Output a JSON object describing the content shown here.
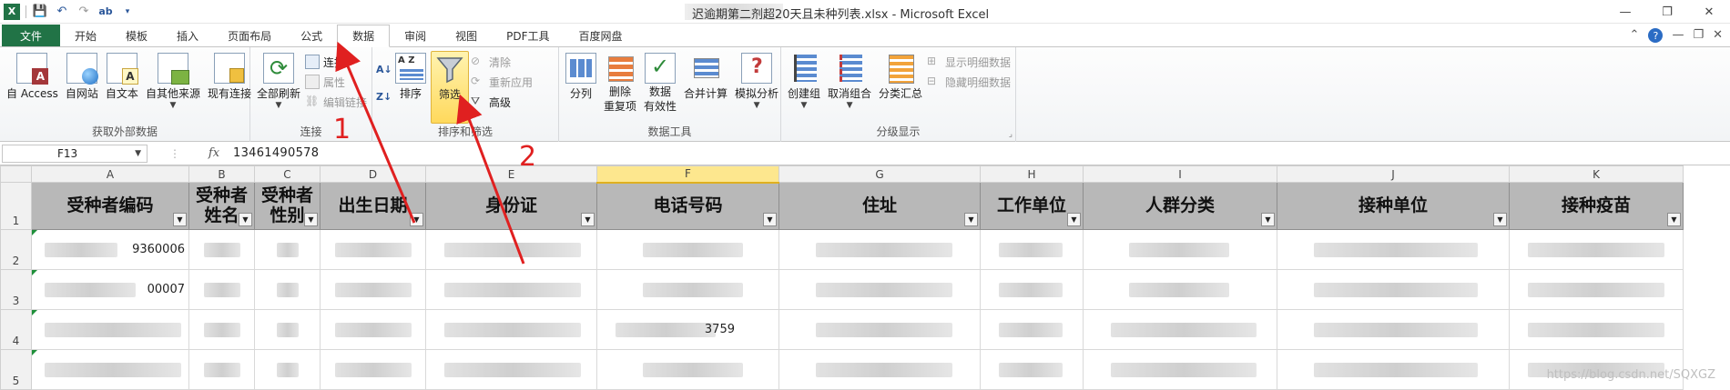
{
  "window": {
    "title": "迟逾期第二剂超20天且未种列表.xlsx - Microsoft Excel",
    "controls": [
      "—",
      "❐",
      "✕"
    ]
  },
  "tabs": [
    {
      "label": "文件"
    },
    {
      "label": "开始"
    },
    {
      "label": "模板"
    },
    {
      "label": "插入"
    },
    {
      "label": "页面布局"
    },
    {
      "label": "公式"
    },
    {
      "label": "数据"
    },
    {
      "label": "审阅"
    },
    {
      "label": "视图"
    },
    {
      "label": "PDF工具"
    },
    {
      "label": "百度网盘"
    }
  ],
  "ribbon": {
    "external": {
      "label": "获取外部数据",
      "buttons": [
        "自 Access",
        "自网站",
        "自文本",
        "自其他来源",
        "现有连接"
      ]
    },
    "connections": {
      "label": "连接",
      "refresh_all": "全部刷新",
      "small": [
        "连接",
        "属性",
        "编辑链接"
      ]
    },
    "sortfilter": {
      "label": "排序和筛选",
      "sort": "排序",
      "filter": "筛选",
      "small": [
        "清除",
        "重新应用",
        "高级"
      ]
    },
    "datatools": {
      "label": "数据工具",
      "buttons": [
        "分列",
        "删除\n重复项",
        "数据\n有效性",
        "合并计算",
        "模拟分析"
      ]
    },
    "outline": {
      "label": "分级显示",
      "buttons": [
        "创建组",
        "取消组合",
        "分类汇总"
      ],
      "small": [
        "显示明细数据",
        "隐藏明细数据"
      ]
    }
  },
  "formula_bar": {
    "name_box": "F13",
    "fx": "fx",
    "value": "13461490578"
  },
  "sheet": {
    "columns": [
      "A",
      "B",
      "C",
      "D",
      "E",
      "F",
      "G",
      "H",
      "I",
      "J",
      "K"
    ],
    "rows": [
      "1",
      "2",
      "3",
      "4",
      "5"
    ],
    "headers": [
      "受种者编码",
      "受种者姓名",
      "受种者性别",
      "出生日期",
      "身份证",
      "电话号码",
      "住址",
      "工作单位",
      "人群分类",
      "接种单位",
      "接种疫苗"
    ],
    "visible_values": {
      "r2_a": "9360006",
      "r3_a": "00007",
      "r4_f": "3759"
    }
  },
  "annotations": {
    "one": "1",
    "two": "2"
  },
  "watermark": "https://blog.csdn.net/SQXGZ",
  "colors": {
    "file_tab": "#217346",
    "selected_column": "#fde78e",
    "annotation": "#e02020",
    "header_fill": "#b8b8b8"
  }
}
